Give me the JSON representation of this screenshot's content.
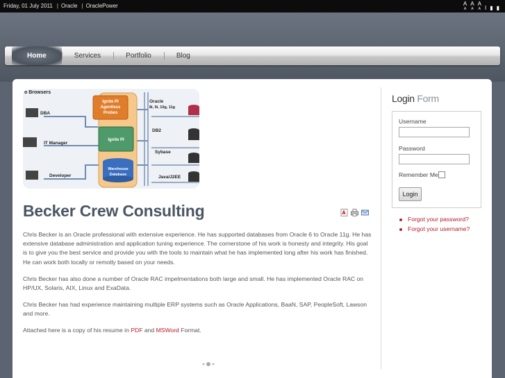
{
  "topbar": {
    "date": "Friday, 01 July 2011",
    "links": [
      "Oracle",
      "OraclePower"
    ],
    "separator": "|",
    "tools": [
      {
        "glyph": "A",
        "sub": "A"
      },
      {
        "glyph": "A",
        "sub": "A"
      },
      {
        "glyph": "A",
        "sub": "A"
      },
      {
        "glyph": "I",
        "sub": ""
      },
      {
        "glyph": "▮",
        "sub": ""
      },
      {
        "glyph": "▮",
        "sub": ""
      }
    ]
  },
  "nav": {
    "items": [
      "Home",
      "Services",
      "Portfolio",
      "Blog"
    ],
    "active": "Home"
  },
  "banner": {
    "labels": {
      "browsers": "o Browsers",
      "dba": "DBA",
      "it_manager": "IT Manager",
      "developer": "Developer",
      "probe": [
        "Ignite PI",
        "Agentless",
        "Probes"
      ],
      "ignite": "Ignite PI",
      "warehouse": [
        "Warehouse",
        "Database"
      ],
      "oracle": [
        "Oracle",
        "8i, 9i, 10g, 11g"
      ],
      "db2": "DB2",
      "sybase": "Sybase",
      "java": "Java/J2EE"
    }
  },
  "article": {
    "title": "Becker Crew Consulting",
    "icons": [
      "pdf-icon",
      "print-icon",
      "email-icon"
    ],
    "p1": "Chris Becker is an Oracle professional with extensive experience.  He has supported databases from Oracle 6 to Oracle 11g.  He has extensive database administration and application tuning  experience.  The cornerstone of his work is honesty and integrity.  His goal is to give you the best service and provide you with the tools to maintain what he has implemented long after his work has finished.  He can work both locally or remotly based on your needs.",
    "p2": "Chris Becker has also done a number of Oracle RAC impelmentations both large and small.  He has implemented Oracle RAC on HP/UX, Solaris, AIX, Linux and ExaData.",
    "p3": "Chris Becker has had experience maintaining multiple ERP systems such as Oracle Applications, BaaN, SAP, PeopleSoft, Lawson and more.",
    "p4_pre": "Attached here is a copy of his resume in ",
    "p4_link1": "PDF",
    "p4_mid": " and ",
    "p4_link2": "MSWord",
    "p4_post": " Format."
  },
  "login": {
    "title_strong": "Login",
    "title_light": " Form",
    "username_label": "Username",
    "username_value": "",
    "password_label": "Password",
    "password_value": "",
    "remember_label": "Remember Me",
    "button": "Login",
    "links": [
      "Forgot your password?",
      "Forgot your username?"
    ]
  },
  "colors": {
    "accent_link": "#b0202a",
    "title": "#4a5663",
    "background": "#5b6470"
  }
}
